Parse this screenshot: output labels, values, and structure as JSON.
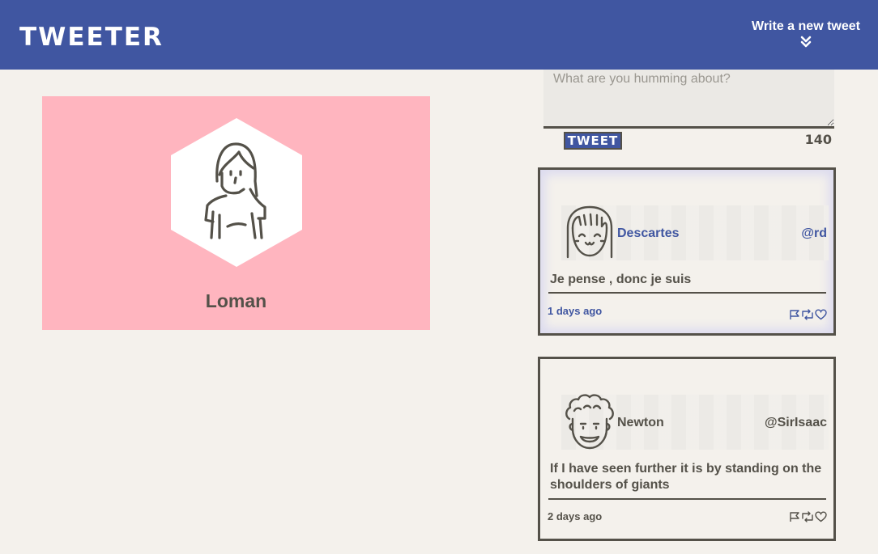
{
  "nav": {
    "brand": "TWEETER",
    "compose_label": "Write a new tweet",
    "compose_icon": "double-chevron-down-icon"
  },
  "profile": {
    "name": "Loman",
    "avatar_icon": "woman-avatar-icon",
    "card_color": "#ffb5bf"
  },
  "composer": {
    "placeholder": "What are you humming about?",
    "value": "",
    "submit_label": "TWEET",
    "char_count": "140"
  },
  "tweets": [
    {
      "author": "Descartes",
      "handle": "@rd",
      "content": "Je pense , donc je suis",
      "age": "1 days ago",
      "avatar_icon": "girl-bangs-avatar-icon",
      "hovered": true
    },
    {
      "author": "Newton",
      "handle": "@SirIsaac",
      "content": "If I have seen further it is by standing on the shoulders of giants",
      "age": "2 days ago",
      "avatar_icon": "curly-hair-avatar-icon",
      "hovered": false
    }
  ],
  "action_icons": [
    "flag-icon",
    "retweet-icon",
    "heart-icon"
  ],
  "colors": {
    "accent": "#4056a1",
    "text": "#545149",
    "background": "#f4f1ec",
    "textarea_bg": "#ebe9e5"
  }
}
